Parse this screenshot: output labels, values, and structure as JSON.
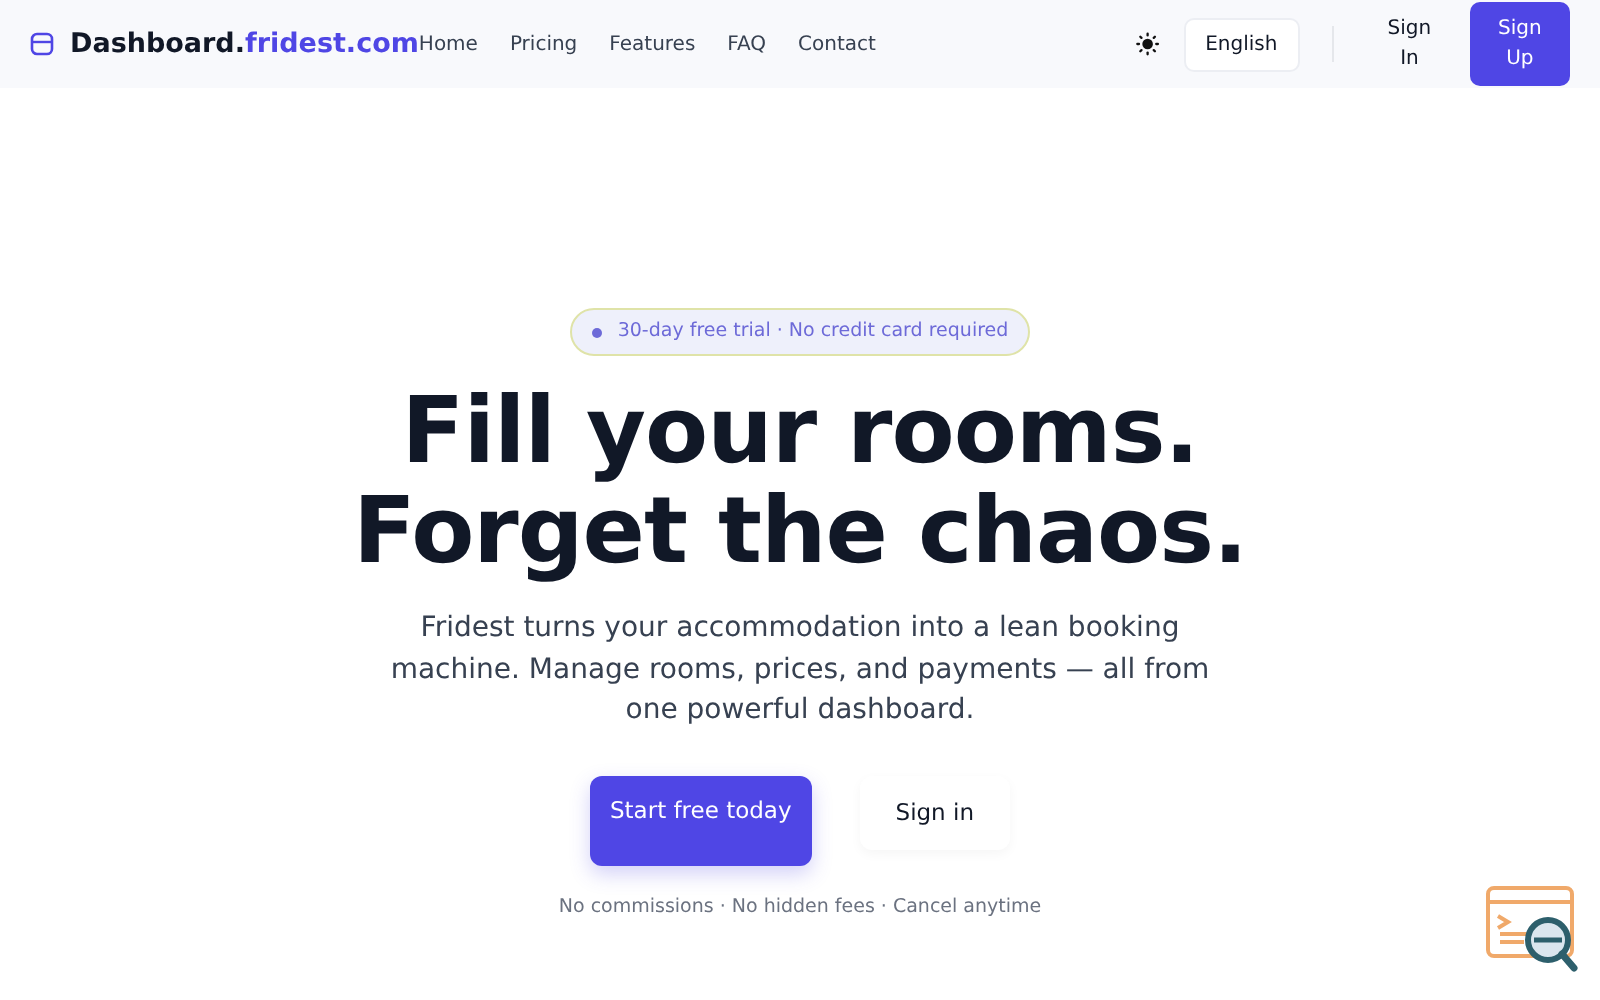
{
  "navbar": {
    "brand_main": "Dashboard.",
    "brand_accent": "fridest.com",
    "links": [
      "Home",
      "Pricing",
      "Features",
      "FAQ",
      "Contact"
    ],
    "language": "English",
    "sign_in": "Sign In",
    "sign_up": "Sign Up"
  },
  "hero": {
    "badge": "30-day free trial · No credit card required",
    "headline": [
      "Fill your rooms.",
      "Forget the chaos."
    ],
    "subtitle": "Fridest turns your accommodation into a lean booking machine. Manage rooms, prices, and payments — all from one powerful dashboard.",
    "primary_button": "Start free today",
    "secondary_button": "Sign in",
    "footnote": "No commissions · No hidden fees · Cancel anytime"
  }
}
